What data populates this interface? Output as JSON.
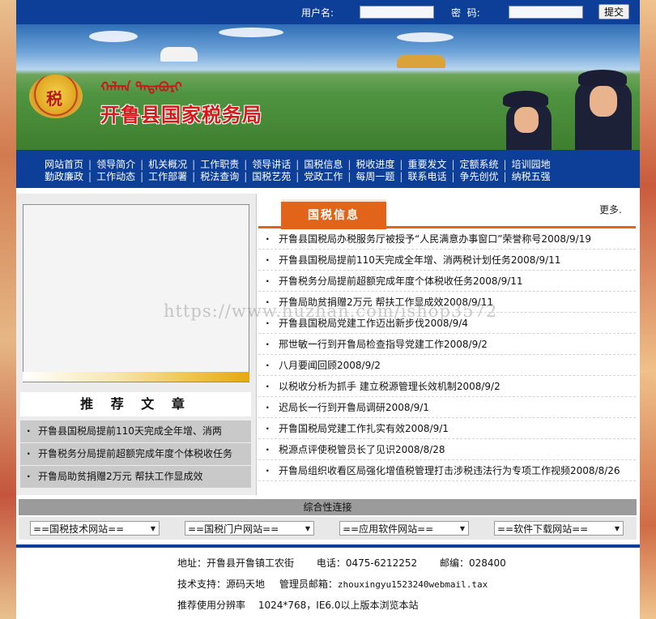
{
  "topbar": {
    "username_label": "用户名:",
    "password_label": "密  码:",
    "submit_label": "提交"
  },
  "banner": {
    "mongolian_text": "ᠬᠠᠯᠬᠠ ᠲᠠᠲᠠᠪᠤᠷᠢ",
    "emblem_char": "税",
    "site_name": "开鲁县国家税务局"
  },
  "nav": {
    "row1": [
      "网站首页",
      "领导简介",
      "机关概况",
      "工作职责",
      "领导讲话",
      "国税信息",
      "税收进度",
      "重要发文",
      "定额系统",
      "培训园地"
    ],
    "row2": [
      "勤政廉政",
      "工作动态",
      "工作部署",
      "税法查询",
      "国税艺苑",
      "党政工作",
      "每周一题",
      "联系电话",
      "争先创优",
      "纳税五强"
    ]
  },
  "recommend": {
    "title": "推 荐 文 章",
    "items": [
      "开鲁县国税局提前110天完成全年增、消两",
      "开鲁税务分局提前超额完成年度个体税收任务",
      "开鲁局助贫捐赠2万元 帮扶工作显成效"
    ]
  },
  "news": {
    "tab_label": "国税信息",
    "more_label": "更多.",
    "items": [
      "开鲁县国税局办税服务厅被授予“人民满意办事窗口”荣誉称号2008/9/19",
      "开鲁县国税局提前110天完成全年增、消两税计划任务2008/9/11",
      "开鲁税务分局提前超额完成年度个体税收任务2008/9/11",
      "开鲁局助贫捐赠2万元 帮扶工作显成效2008/9/11",
      "开鲁县国税局党建工作迈出新步伐2008/9/4",
      "邢世敏一行到开鲁局检查指导党建工作2008/9/2",
      "八月要闻回顾2008/9/2",
      "以税收分析为抓手 建立税源管理长效机制2008/9/2",
      "迟局长一行到开鲁局调研2008/9/1",
      "开鲁国税局党建工作扎实有效2008/9/1",
      "税源点评使税管员长了见识2008/8/28",
      "开鲁局组织收看区局强化增值税管理打击涉税违法行为专项工作视频2008/8/26"
    ]
  },
  "links": {
    "title": "综合性连接",
    "selects": [
      "==国税技术网站==",
      "==国税门户网站==",
      "==应用软件网站==",
      "==软件下载网站=="
    ]
  },
  "footer": {
    "address": "地址：开鲁县开鲁镇工农街",
    "phone": "电话：0475-6212252",
    "zip": "邮编：028400",
    "tech_support": "技术支持：源码天地",
    "admin_email_label": "管理员邮箱：",
    "admin_email": "zhouxingyu1523240webmail.tax",
    "resolution_label": "推荐使用分辨率",
    "resolution_text": "1024*768，IE6.0以上版本浏览本站"
  },
  "watermark": "https://www.huzhan.com/ishop3572",
  "colors": {
    "nav_blue": "#0d3f99",
    "tab_orange": "#e2631a",
    "title_red": "#d71818"
  }
}
